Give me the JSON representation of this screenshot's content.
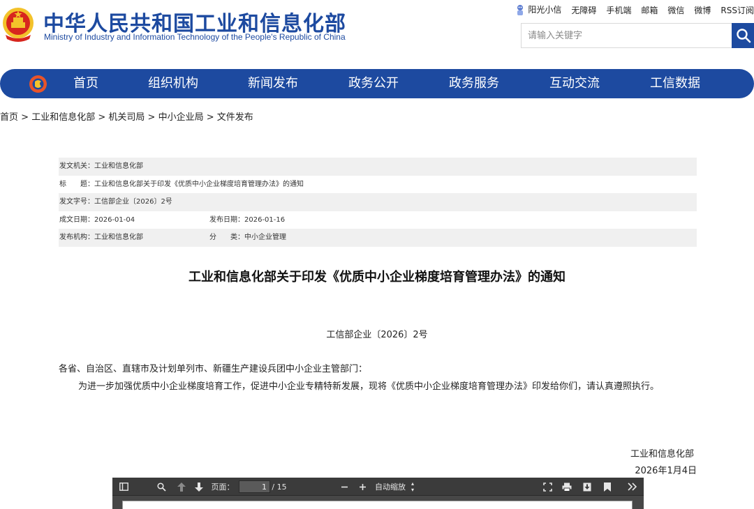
{
  "header": {
    "title": "中华人民共和国工业和信息化部",
    "subtitle": "Ministry of Industry and Information Technology of the People's Republic of China",
    "emblem_icon": "national-emblem-icon"
  },
  "toplinks": [
    "阳光小信",
    "无障碍",
    "手机端",
    "邮箱",
    "微信",
    "微博",
    "RSS订阅"
  ],
  "search": {
    "placeholder": "请输入关键字",
    "icon": "search-icon"
  },
  "nav": {
    "items": [
      "首页",
      "组织机构",
      "新闻发布",
      "政务公开",
      "政务服务",
      "互动交流",
      "工信数据"
    ]
  },
  "breadcrumb": [
    "首页",
    "工业和信息化部",
    "机关司局",
    "中小企业局",
    "文件发布"
  ],
  "meta": {
    "issuer": "发文机关：工业和信息化部",
    "title": "标　　题：工业和信息化部关于印发《优质中小企业梯度培育管理办法》的通知",
    "doc_no": "发文字号：工信部企业〔2026〕2号",
    "created": "成文日期：2026-01-04",
    "published": "发布日期：2026-01-16",
    "agency": "发布机构：工业和信息化部",
    "category": "分　　类：中小企业管理"
  },
  "document": {
    "title": "工业和信息化部关于印发《优质中小企业梯度培育管理办法》的通知",
    "number": "工信部企业〔2026〕2号",
    "recipients": "各省、自治区、直辖市及计划单列市、新疆生产建设兵团中小企业主管部门：",
    "body": "为进一步加强优质中小企业梯度培育工作，促进中小企业专精特新发展，现将《优质中小企业梯度培育管理办法》印发给你们，请认真遵照执行。",
    "sign_org": "工业和信息化部",
    "sign_date": "2026年1月4日"
  },
  "pdf_viewer": {
    "page_label": "页面：",
    "current_page": "1",
    "total_pages": "/ 15",
    "zoom": "自动缩放"
  },
  "colors": {
    "brand": "#1d4aa0",
    "emblem_red": "#d7261e",
    "emblem_gold": "#f3c22a"
  }
}
